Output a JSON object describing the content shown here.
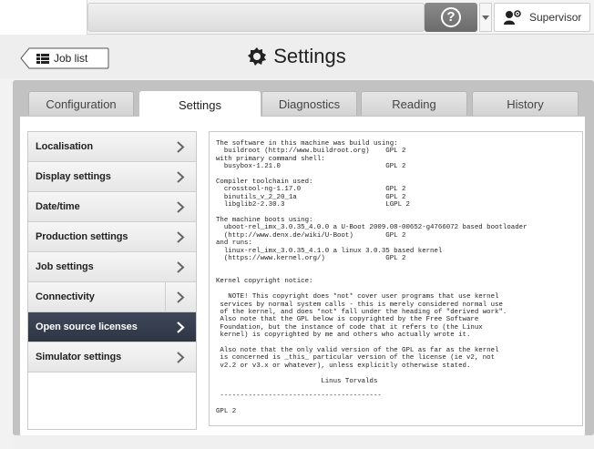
{
  "topbar": {
    "help_label": "?",
    "user_name": "Supervisor"
  },
  "header": {
    "back_label": "Job list",
    "title": "Settings"
  },
  "tabs": [
    {
      "label": "Configuration",
      "active": false
    },
    {
      "label": "Settings",
      "active": true
    },
    {
      "label": "Diagnostics",
      "active": false
    },
    {
      "label": "Reading",
      "active": false
    },
    {
      "label": "History",
      "active": false
    }
  ],
  "sidebar": {
    "items": [
      {
        "label": "Localisation"
      },
      {
        "label": "Display settings"
      },
      {
        "label": "Date/time"
      },
      {
        "label": "Production settings"
      },
      {
        "label": "Job settings"
      },
      {
        "label": "Connectivity"
      },
      {
        "label": "Open source licenses"
      },
      {
        "label": "Simulator settings"
      }
    ],
    "active_index": 6
  },
  "license_text": "The software in this machine was build using:\n  buildroot (http://www.buildroot.org)    GPL 2\nwith primary command shell:\n  busybox-1.21.0                          GPL 2\n\nCompiler toolchain used:\n  crosstool-ng-1.17.0                     GPL 2\n  binutils_v_2_20_1a                      GPL 2\n  libglib2-2.30.3                         LGPL 2\n\nThe machine boots using:\n  uboot-rel_imx_3.0.35_4.0.0 a U-Boot 2009.08-00652-g4766072 based bootloader\n  (http://www.denx.de/wiki/U-Boot)        GPL 2\nand runs:\n  linux-rel_imx_3.0.35_4.1.0 a linux 3.0.35 based kernel\n  (https://www.kernel.org/)               GPL 2\n\n\nKernel copyright notice:\n\n   NOTE! This copyright does *not* cover user programs that use kernel\n services by normal system calls - this is merely considered normal use\n of the kernel, and does *not* fall under the heading of \"derived work\".\n Also note that the GPL below is copyrighted by the Free Software\n Foundation, but the instance of code that it refers to (the Linux\n kernel) is copyrighted by me and others who actually wrote it.\n\n Also note that the only valid version of the GPL as far as the kernel\n is concerned is _this_ particular version of the license (ie v2, not\n v2.2 or v3.x or whatever), unless explicitly otherwise stated.\n\n                          Linus Torvalds\n\n ----------------------------------------\n\nGPL 2",
  "colors": {
    "active_item_bg": "#343c4d",
    "panel_bg": "#c2c2c2",
    "help_bg": "#7a7a7a"
  }
}
